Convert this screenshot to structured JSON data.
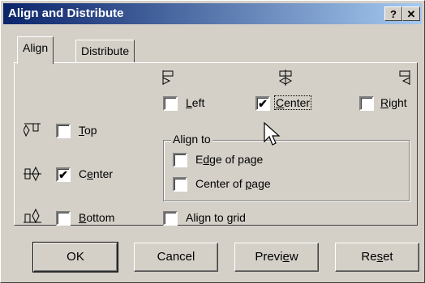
{
  "window": {
    "title": "Align and Distribute",
    "help_btn": "?",
    "close_btn": "✕"
  },
  "tabs": [
    {
      "label": "Align"
    },
    {
      "label": "Distribute"
    }
  ],
  "horizontal": {
    "left": {
      "label_pre": "",
      "label_u": "L",
      "label_post": "eft",
      "checked": false,
      "glyph": "⊏◇"
    },
    "center": {
      "label_pre": "",
      "label_u": "C",
      "label_post": "enter",
      "checked": true,
      "glyph": "⊏◇"
    },
    "right": {
      "label_pre": "",
      "label_u": "R",
      "label_post": "ight",
      "checked": false,
      "glyph": "⊏◇"
    }
  },
  "vertical": {
    "top": {
      "label_u": "T",
      "label_post": "op",
      "checked": false
    },
    "center": {
      "label_pre": "C",
      "label_u": "e",
      "label_post": "nter",
      "checked": true
    },
    "bottom": {
      "label_u": "B",
      "label_post": "ottom",
      "checked": false
    }
  },
  "align_to": {
    "title": "Align to",
    "edge": {
      "label_pre": "E",
      "label_u": "d",
      "label_post": "ge of page",
      "checked": false
    },
    "center": {
      "label_pre": "Center of ",
      "label_u": "p",
      "label_post": "age",
      "checked": false
    }
  },
  "grid": {
    "label_pre": "Align to ",
    "label_u": "g",
    "label_post": "rid",
    "checked": false
  },
  "buttons": {
    "ok": "OK",
    "cancel": "Cancel",
    "preview_pre": "Previ",
    "preview_u": "e",
    "preview_post": "w",
    "reset_pre": "Re",
    "reset_u": "s",
    "reset_post": "et"
  },
  "check_mark": "✔"
}
